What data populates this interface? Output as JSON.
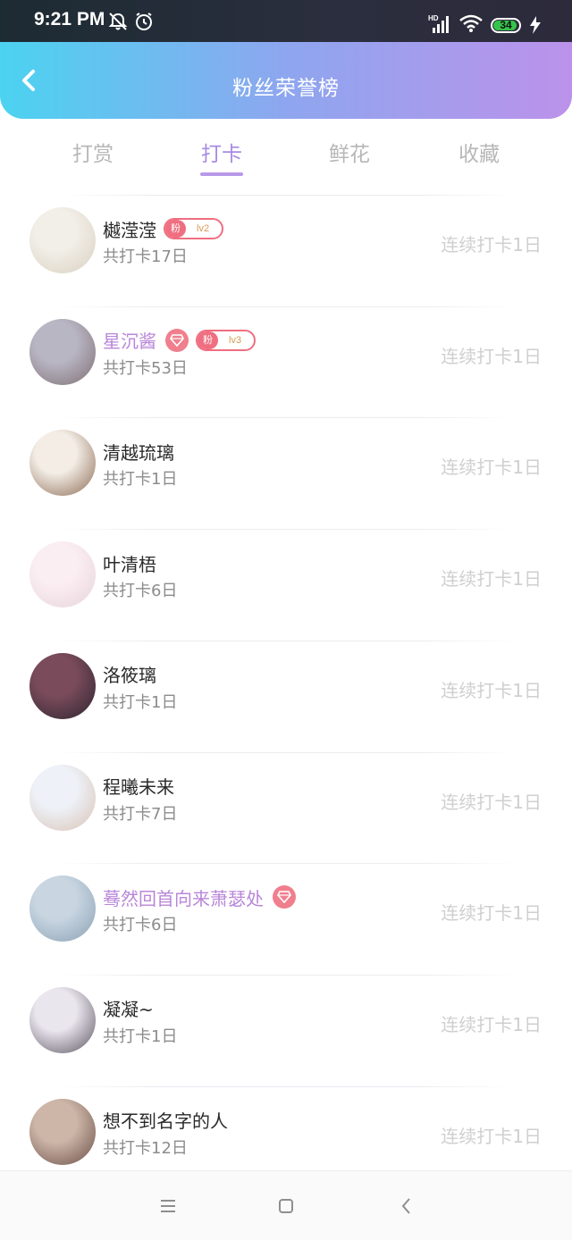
{
  "status_bar": {
    "time": "9:21 PM",
    "battery_level": 34,
    "icons": [
      "mute-bell-icon",
      "alarm-icon",
      "hd-signal-icon",
      "wifi-icon",
      "battery-icon",
      "charging-icon"
    ]
  },
  "header": {
    "title": "粉丝荣誉榜",
    "back_icon": "chevron-left-icon"
  },
  "tabs": [
    {
      "label": "打赏",
      "active": false
    },
    {
      "label": "打卡",
      "active": true
    },
    {
      "label": "鲜花",
      "active": false
    },
    {
      "label": "收藏",
      "active": false
    }
  ],
  "list": [
    {
      "name": "樾滢滢",
      "vip": false,
      "fan_badge": {
        "label": "粉",
        "level": "lv2"
      },
      "total": "共打卡17日",
      "streak": "连续打卡1日",
      "avatar_colors": [
        "#f2efe8",
        "#d9cfc0"
      ]
    },
    {
      "name": "星沉酱",
      "vip": true,
      "fan_badge": {
        "label": "粉",
        "level": "lv3"
      },
      "total": "共打卡53日",
      "streak": "连续打卡1日",
      "avatar_colors": [
        "#b9b6c4",
        "#7e6f74"
      ]
    },
    {
      "name": "清越琉璃",
      "vip": false,
      "fan_badge": null,
      "total": "共打卡1日",
      "streak": "连续打卡1日",
      "avatar_colors": [
        "#f3ede6",
        "#8b6a52"
      ]
    },
    {
      "name": "叶清梧",
      "vip": false,
      "fan_badge": null,
      "total": "共打卡6日",
      "streak": "连续打卡1日",
      "avatar_colors": [
        "#fbeef2",
        "#e6d4dc"
      ]
    },
    {
      "name": "洛筱璃",
      "vip": false,
      "fan_badge": null,
      "total": "共打卡1日",
      "streak": "连续打卡1日",
      "avatar_colors": [
        "#7a4b5a",
        "#2c2430"
      ]
    },
    {
      "name": "程曦未来",
      "vip": false,
      "fan_badge": null,
      "total": "共打卡7日",
      "streak": "连续打卡1日",
      "avatar_colors": [
        "#eef2f8",
        "#d8c2b5"
      ]
    },
    {
      "name": "蓦然回首向来萧瑟处",
      "vip": true,
      "fan_badge": null,
      "total": "共打卡6日",
      "streak": "连续打卡1日",
      "avatar_colors": [
        "#c9d6e2",
        "#8aa0b3"
      ]
    },
    {
      "name": "凝凝~",
      "vip": false,
      "fan_badge": null,
      "total": "共打卡1日",
      "streak": "连续打卡1日",
      "avatar_colors": [
        "#eae6ee",
        "#5a5460"
      ]
    },
    {
      "name": "想不到名字的人",
      "vip": false,
      "fan_badge": null,
      "total": "共打卡12日",
      "streak": "连续打卡1日",
      "avatar_colors": [
        "#cdb6a8",
        "#6a4e46"
      ]
    }
  ],
  "nav_bar": {
    "icons": [
      "menu-icon",
      "home-square-icon",
      "back-triangle-icon"
    ]
  }
}
